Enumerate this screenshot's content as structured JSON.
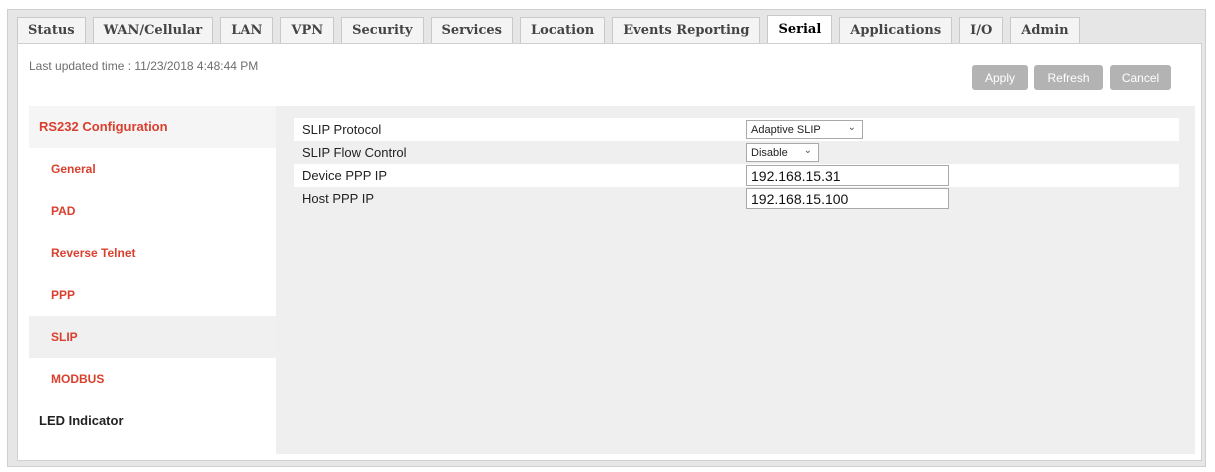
{
  "tabs": [
    {
      "label": "Status"
    },
    {
      "label": "WAN/Cellular"
    },
    {
      "label": "LAN"
    },
    {
      "label": "VPN"
    },
    {
      "label": "Security"
    },
    {
      "label": "Services"
    },
    {
      "label": "Location"
    },
    {
      "label": "Events Reporting"
    },
    {
      "label": "Serial",
      "active": true
    },
    {
      "label": "Applications"
    },
    {
      "label": "I/O"
    },
    {
      "label": "Admin"
    }
  ],
  "header": {
    "last_updated": "Last updated time : 11/23/2018 4:48:44 PM",
    "apply_label": "Apply",
    "refresh_label": "Refresh",
    "cancel_label": "Cancel"
  },
  "sidebar": {
    "items": [
      {
        "label": "RS232 Configuration"
      },
      {
        "label": "General"
      },
      {
        "label": "PAD"
      },
      {
        "label": "Reverse Telnet"
      },
      {
        "label": "PPP"
      },
      {
        "label": "SLIP",
        "selected": true
      },
      {
        "label": "MODBUS"
      },
      {
        "label": "LED Indicator"
      }
    ]
  },
  "form": {
    "slip_protocol": {
      "label": "SLIP Protocol",
      "value": "Adaptive SLIP"
    },
    "slip_flow_control": {
      "label": "SLIP Flow Control",
      "value": "Disable"
    },
    "device_ppp_ip": {
      "label": "Device PPP IP",
      "value": "192.168.15.31"
    },
    "host_ppp_ip": {
      "label": "Host PPP IP",
      "value": "192.168.15.100"
    }
  },
  "colors": {
    "accent_red": "#d9402e",
    "button_gray": "#b3b3b3",
    "panel_gray": "#efefef"
  }
}
